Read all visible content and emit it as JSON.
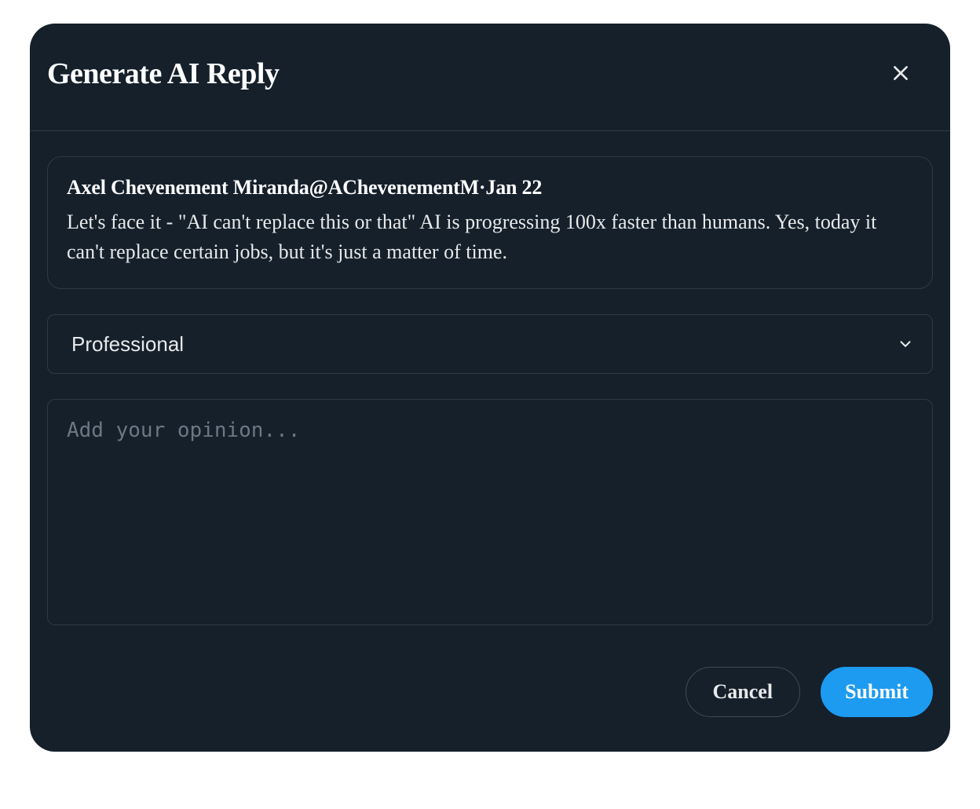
{
  "modal": {
    "title": "Generate AI Reply"
  },
  "tweet": {
    "header": "Axel Chevenement Miranda@AChevenementM·Jan 22",
    "body": "Let's face it - \"AI can't replace this or that\" AI is progressing 100x faster than humans. Yes, today it can't replace certain jobs, but it's just a matter of time."
  },
  "tone": {
    "selected": "Professional"
  },
  "opinion": {
    "value": "",
    "placeholder": "Add your opinion..."
  },
  "buttons": {
    "cancel": "Cancel",
    "submit": "Submit"
  },
  "colors": {
    "background": "#15202b",
    "border": "#2d3a46",
    "accent": "#1d9bf0",
    "text": "#e7e9ea"
  }
}
